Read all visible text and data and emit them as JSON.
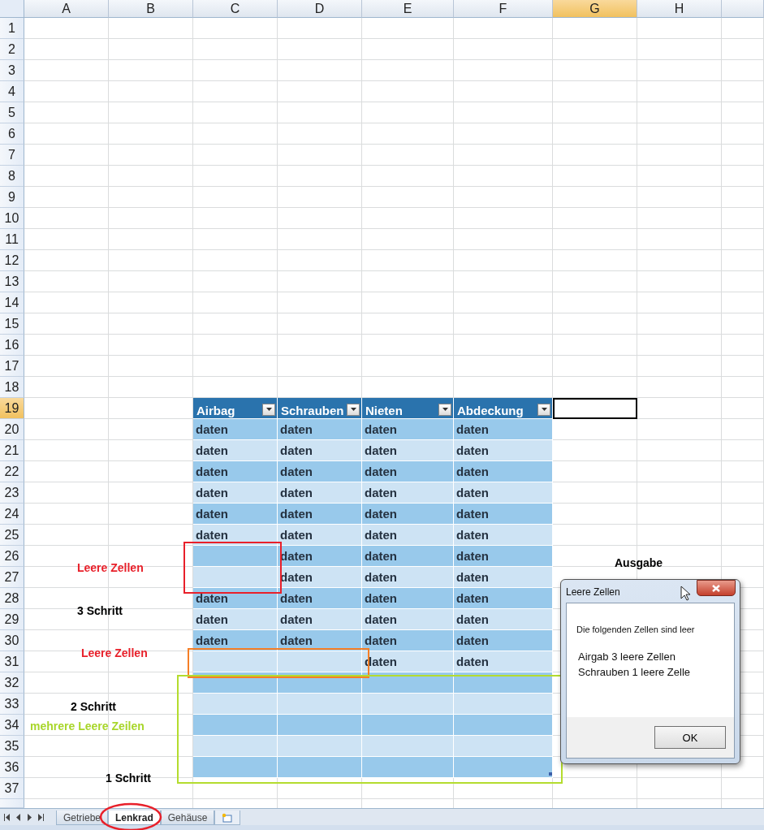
{
  "column_headings": [
    {
      "label": "A",
      "selected": false
    },
    {
      "label": "B",
      "selected": false
    },
    {
      "label": "C",
      "selected": false
    },
    {
      "label": "D",
      "selected": false
    },
    {
      "label": "E",
      "selected": false
    },
    {
      "label": "F",
      "selected": false
    },
    {
      "label": "G",
      "selected": true
    },
    {
      "label": "H",
      "selected": false
    }
  ],
  "row_numbers": [
    {
      "label": "1",
      "selected": false
    },
    {
      "label": "2",
      "selected": false
    },
    {
      "label": "3",
      "selected": false
    },
    {
      "label": "4",
      "selected": false
    },
    {
      "label": "5",
      "selected": false
    },
    {
      "label": "6",
      "selected": false
    },
    {
      "label": "7",
      "selected": false
    },
    {
      "label": "8",
      "selected": false
    },
    {
      "label": "9",
      "selected": false
    },
    {
      "label": "10",
      "selected": false
    },
    {
      "label": "11",
      "selected": false
    },
    {
      "label": "12",
      "selected": false
    },
    {
      "label": "13",
      "selected": false
    },
    {
      "label": "14",
      "selected": false
    },
    {
      "label": "15",
      "selected": false
    },
    {
      "label": "16",
      "selected": false
    },
    {
      "label": "17",
      "selected": false
    },
    {
      "label": "18",
      "selected": false
    },
    {
      "label": "19",
      "selected": true
    },
    {
      "label": "20",
      "selected": false
    },
    {
      "label": "21",
      "selected": false
    },
    {
      "label": "22",
      "selected": false
    },
    {
      "label": "23",
      "selected": false
    },
    {
      "label": "24",
      "selected": false
    },
    {
      "label": "25",
      "selected": false
    },
    {
      "label": "26",
      "selected": false
    },
    {
      "label": "27",
      "selected": false
    },
    {
      "label": "28",
      "selected": false
    },
    {
      "label": "29",
      "selected": false
    },
    {
      "label": "30",
      "selected": false
    },
    {
      "label": "31",
      "selected": false
    },
    {
      "label": "32",
      "selected": false
    },
    {
      "label": "33",
      "selected": false
    },
    {
      "label": "34",
      "selected": false
    },
    {
      "label": "35",
      "selected": false
    },
    {
      "label": "36",
      "selected": false
    },
    {
      "label": "37",
      "selected": false
    }
  ],
  "table": {
    "columns": [
      "Airbag",
      "Schrauben",
      "Nieten",
      "Abdeckung"
    ],
    "rows": [
      {
        "cells": [
          "daten",
          "daten",
          "daten",
          "daten"
        ]
      },
      {
        "cells": [
          "daten",
          "daten",
          "daten",
          "daten"
        ]
      },
      {
        "cells": [
          "daten",
          "daten",
          "daten",
          "daten"
        ]
      },
      {
        "cells": [
          "daten",
          "daten",
          "daten",
          "daten"
        ]
      },
      {
        "cells": [
          "daten",
          "daten",
          "daten",
          "daten"
        ]
      },
      {
        "cells": [
          "daten",
          "daten",
          "daten",
          "daten"
        ]
      },
      {
        "cells": [
          null,
          "daten",
          "daten",
          "daten"
        ]
      },
      {
        "cells": [
          null,
          "daten",
          "daten",
          "daten"
        ]
      },
      {
        "cells": [
          "daten",
          "daten",
          "daten",
          "daten"
        ]
      },
      {
        "cells": [
          "daten",
          "daten",
          "daten",
          "daten"
        ]
      },
      {
        "cells": [
          "daten",
          "daten",
          "daten",
          "daten"
        ]
      },
      {
        "cells": [
          null,
          null,
          "daten",
          "daten"
        ]
      },
      {
        "cells": [
          null,
          null,
          null,
          null
        ]
      },
      {
        "cells": [
          null,
          null,
          null,
          null
        ]
      },
      {
        "cells": [
          null,
          null,
          null,
          null
        ]
      },
      {
        "cells": [
          null,
          null,
          null,
          null
        ]
      },
      {
        "cells": [
          null,
          null,
          null,
          null
        ]
      }
    ]
  },
  "annotations": [
    {
      "text": "Leere Zellen",
      "color": "#e8202a"
    },
    {
      "text": "3 Schritt",
      "color": "#000000"
    },
    {
      "text": "Leere Zellen",
      "color": "#e8202a"
    },
    {
      "text": "2 Schritt",
      "color": "#000000"
    },
    {
      "text": "mehrere Leere Zeilen",
      "color": "#a8d62a"
    },
    {
      "text": "1 Schritt",
      "color": "#000000"
    },
    {
      "text": "Ausgabe",
      "color": "#000000"
    }
  ],
  "highlight_frames": [
    {
      "color": "#e8202a"
    },
    {
      "color": "#f57f27"
    },
    {
      "color": "#b4dc2e"
    }
  ],
  "dialog": {
    "title": "Leere Zellen",
    "message": "Die folgenden Zellen sind leer",
    "lines": [
      "Airgab 3 leere Zellen",
      "Schrauben 1 leere Zelle"
    ],
    "button": "OK"
  },
  "sheet_tabs": [
    {
      "label": "Getriebe",
      "selected": false
    },
    {
      "label": "Lenkrad",
      "selected": true
    },
    {
      "label": "Gehäuse",
      "selected": false
    }
  ]
}
